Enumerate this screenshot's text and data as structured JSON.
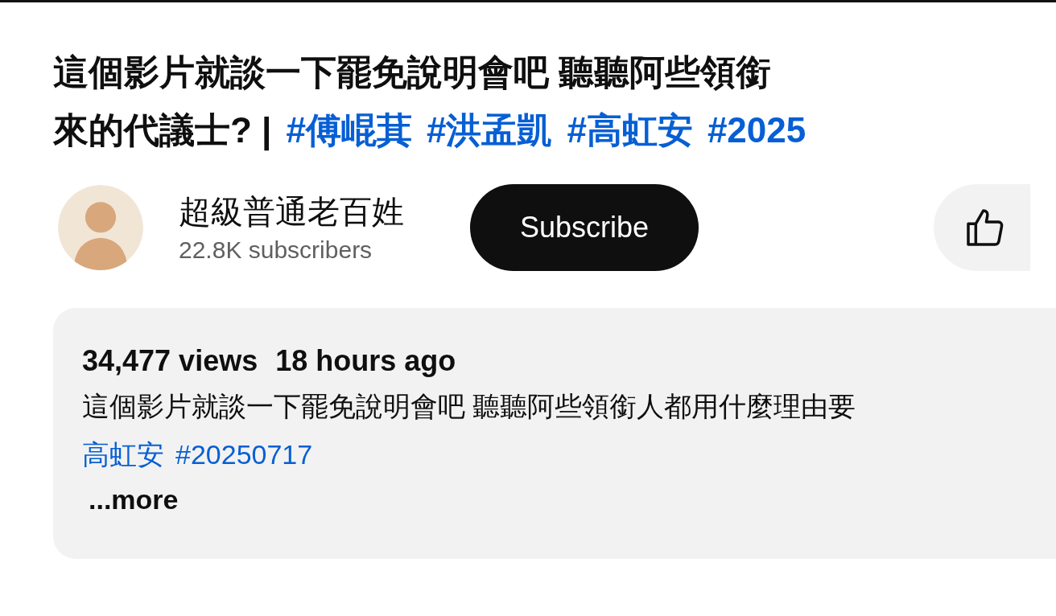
{
  "title": {
    "lines": [
      {
        "text": "這個影片就談一下罷免說明會吧 聽聽阿些領銜"
      },
      {
        "text": "來的代議士? |",
        "hashtags": [
          "#傅崐萁",
          "#洪孟凱",
          "#高虹安",
          "#2025"
        ]
      }
    ]
  },
  "channel": {
    "name": "超級普通老百姓",
    "subscribers": "22.8K subscribers",
    "subscribe_label": "Subscribe"
  },
  "description": {
    "stats": [
      "34,477 views",
      "18 hours ago"
    ],
    "line_1": "這個影片就談一下罷免說明會吧 聽聽阿些領銜人都用什麼理由要",
    "line_2_links": [
      "高虹安",
      "#20250717"
    ],
    "more": "...more"
  }
}
